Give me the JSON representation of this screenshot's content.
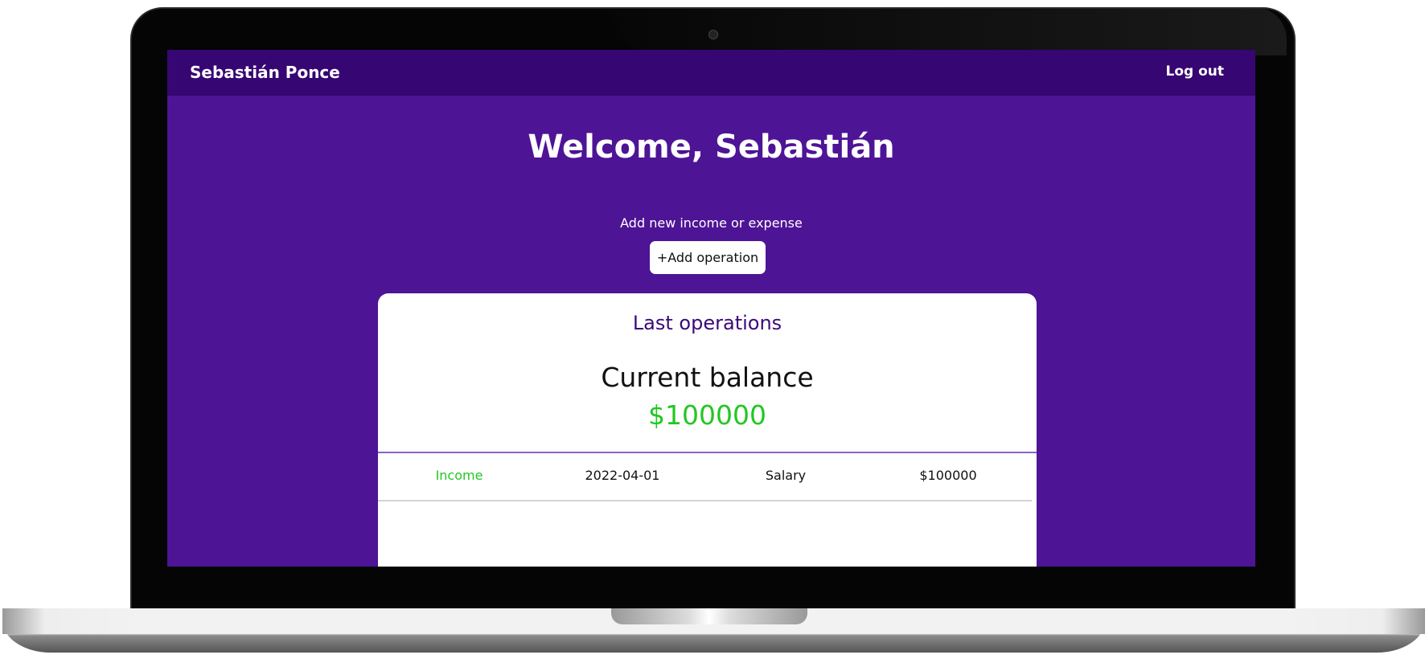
{
  "header": {
    "brand": "Sebastián Ponce",
    "logout_label": "Log out"
  },
  "main": {
    "welcome": "Welcome, Sebastián",
    "add_label": "Add new income or expense",
    "add_button": "+Add operation"
  },
  "card": {
    "title": "Last operations",
    "balance_label": "Current balance",
    "balance_value": "$100000",
    "operations": [
      {
        "type": "Income",
        "date": "2022-04-01",
        "concept": "Salary",
        "amount": "$100000"
      }
    ]
  },
  "colors": {
    "background": "#4e1496",
    "navbar": "#360673",
    "income": "#22c722",
    "title": "#3a0a7a"
  }
}
